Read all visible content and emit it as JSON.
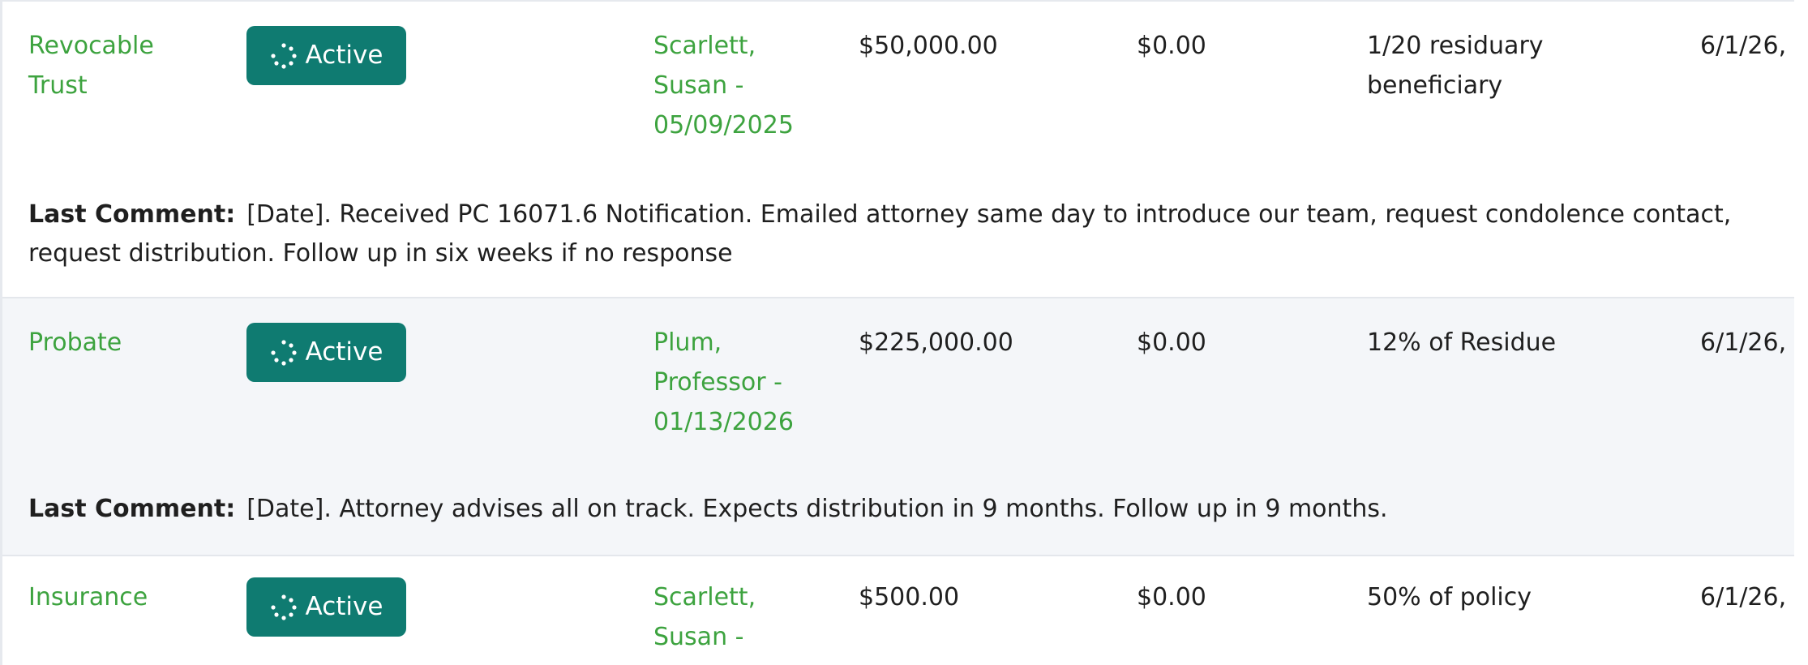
{
  "colors": {
    "link_green": "#3da33f",
    "badge_teal": "#0f7b71",
    "row_shade": "#f4f6f9",
    "border": "#e4e7ec"
  },
  "comment_label": "Last Comment:",
  "records": [
    {
      "type": "Revocable Trust",
      "status": "Active",
      "status_icon": "spinner-icon",
      "contact": "Scarlett, Susan - 05/09/2025",
      "amount": "$50,000.00",
      "paid": "$0.00",
      "share": "1/20 residuary beneficiary",
      "date": "6/1/26,",
      "comment": "[Date]. Received PC 16071.6 Notification. Emailed attorney same day to introduce our team, request condolence contact, request distribution. Follow up in six weeks if no response"
    },
    {
      "type": "Probate",
      "status": "Active",
      "status_icon": "spinner-icon",
      "contact": "Plum, Professor - 01/13/2026",
      "amount": "$225,000.00",
      "paid": "$0.00",
      "share": "12% of Residue",
      "date": "6/1/26,",
      "comment": "[Date]. Attorney advises all on track. Expects distribution in 9 months. Follow up in 9 months."
    },
    {
      "type": "Insurance",
      "status": "Active",
      "status_icon": "spinner-icon",
      "contact": "Scarlett, Susan -",
      "amount": "$500.00",
      "paid": "$0.00",
      "share": "50% of policy",
      "date": "6/1/26,"
    }
  ]
}
